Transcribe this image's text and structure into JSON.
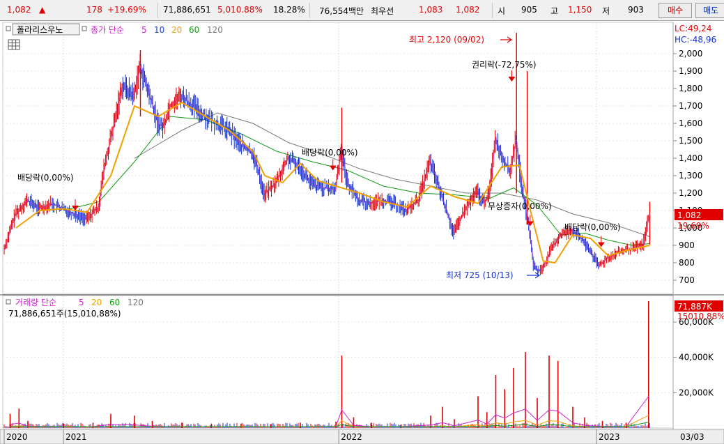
{
  "quote_bar": {
    "price": "1,082",
    "change_arrow": "▲",
    "change": "178",
    "change_pct": "+19.69%",
    "volume": "71,886,651",
    "volume_ratio": "5,010.88%",
    "turnover": "18.28%",
    "trade_value": "76,554백만",
    "ask_label": "최우선",
    "best_ask": "1,083",
    "best_bid": "1,082",
    "open_label": "시",
    "open": "905",
    "high_label": "고",
    "high": "1,150",
    "low_label": "저",
    "low": "903",
    "buy_label": "매수",
    "sell_label": "매도"
  },
  "price_panel": {
    "name_tag": "폴라리스우노",
    "ma_title": "종가 단순",
    "ma_periods": [
      "5",
      "10",
      "20",
      "60",
      "120"
    ],
    "lc_label": "LC:49,24",
    "hc_label": "HC:-48,96",
    "current_price_label": "1,082",
    "current_pct_label": "19,69%",
    "annotations": {
      "high": "최고 2,120 (09/02)",
      "rights_off": "권리락(-72,75%)",
      "div1": "배당락(0,00%)",
      "div2": "배당락(0,00%)",
      "bonus": "무상증자(0,00%)",
      "div3": "배당락(0,00%)",
      "low": "최저 725 (10/13)"
    }
  },
  "volume_panel": {
    "title": "거래량 단순",
    "ma_periods": [
      "5",
      "20",
      "60",
      "120"
    ],
    "summary": "71,886,651주(15,010,88%)",
    "current_volume_label": "71,887K",
    "current_pct_label": "15010,88%"
  },
  "colors": {
    "candle_up": "#e00000",
    "candle_down": "#1530d0",
    "ma5": "#d020d0",
    "ma10": "#1e3cc8",
    "ma20": "#f0a000",
    "ma60": "#119911",
    "ma120": "#777777"
  },
  "chart_data": {
    "type": "candlestick",
    "x_axis_labels": [
      "2020",
      "2021",
      "2022",
      "2023",
      "03/03"
    ],
    "price_axis_ticks": [
      "700",
      "800",
      "900",
      "1,000",
      "1,100",
      "1,200",
      "1,300",
      "1,400",
      "1,500",
      "1,600",
      "1,700",
      "1,800",
      "1,900",
      "2,000"
    ],
    "volume_axis_ticks": [
      "20,000K",
      "40,000K",
      "60,000K"
    ],
    "ylim_price": [
      620,
      2180
    ],
    "ylim_volume": [
      0,
      75000
    ],
    "price_path": [
      [
        0,
        870
      ],
      [
        0.02,
        1080
      ],
      [
        0.04,
        1160
      ],
      [
        0.06,
        1110
      ],
      [
        0.08,
        1140
      ],
      [
        0.1,
        1110
      ],
      [
        0.12,
        1080
      ],
      [
        0.14,
        1050
      ],
      [
        0.16,
        1120
      ],
      [
        0.17,
        1350
      ],
      [
        0.19,
        1650
      ],
      [
        0.2,
        1820
      ],
      [
        0.22,
        1760
      ],
      [
        0.23,
        1930
      ],
      [
        0.25,
        1720
      ],
      [
        0.26,
        1600
      ],
      [
        0.27,
        1580
      ],
      [
        0.28,
        1700
      ],
      [
        0.3,
        1760
      ],
      [
        0.32,
        1700
      ],
      [
        0.34,
        1640
      ],
      [
        0.36,
        1600
      ],
      [
        0.38,
        1560
      ],
      [
        0.4,
        1480
      ],
      [
        0.42,
        1430
      ],
      [
        0.43,
        1330
      ],
      [
        0.44,
        1190
      ],
      [
        0.46,
        1260
      ],
      [
        0.48,
        1400
      ],
      [
        0.5,
        1350
      ],
      [
        0.52,
        1250
      ],
      [
        0.54,
        1230
      ],
      [
        0.56,
        1220
      ],
      [
        0.57,
        1460
      ],
      [
        0.58,
        1260
      ],
      [
        0.6,
        1160
      ],
      [
        0.62,
        1140
      ],
      [
        0.64,
        1160
      ],
      [
        0.66,
        1140
      ],
      [
        0.68,
        1100
      ],
      [
        0.7,
        1160
      ],
      [
        0.72,
        1380
      ],
      [
        0.74,
        1180
      ],
      [
        0.76,
        970
      ],
      [
        0.78,
        1110
      ],
      [
        0.8,
        1210
      ],
      [
        0.81,
        1140
      ],
      [
        0.82,
        1200
      ],
      [
        0.83,
        1520
      ],
      [
        0.84,
        1420
      ],
      [
        0.855,
        1320
      ],
      [
        0.865,
        1510
      ],
      [
        0.875,
        1230
      ],
      [
        0.885,
        1040
      ],
      [
        0.895,
        780
      ],
      [
        0.905,
        750
      ],
      [
        0.915,
        800
      ],
      [
        0.925,
        880
      ],
      [
        0.94,
        960
      ],
      [
        0.96,
        990
      ],
      [
        0.975,
        940
      ],
      [
        0.99,
        870
      ],
      [
        1.005,
        780
      ],
      [
        1.02,
        830
      ],
      [
        1.04,
        860
      ],
      [
        1.06,
        880
      ],
      [
        1.08,
        905
      ],
      [
        1.09,
        1082
      ]
    ],
    "ma20_path": [
      [
        0.02,
        1000
      ],
      [
        0.06,
        1100
      ],
      [
        0.1,
        1110
      ],
      [
        0.14,
        1090
      ],
      [
        0.18,
        1300
      ],
      [
        0.22,
        1700
      ],
      [
        0.26,
        1640
      ],
      [
        0.3,
        1720
      ],
      [
        0.34,
        1640
      ],
      [
        0.38,
        1560
      ],
      [
        0.42,
        1440
      ],
      [
        0.44,
        1300
      ],
      [
        0.47,
        1260
      ],
      [
        0.5,
        1370
      ],
      [
        0.53,
        1270
      ],
      [
        0.56,
        1240
      ],
      [
        0.6,
        1200
      ],
      [
        0.64,
        1150
      ],
      [
        0.68,
        1120
      ],
      [
        0.72,
        1240
      ],
      [
        0.76,
        1180
      ],
      [
        0.8,
        1140
      ],
      [
        0.84,
        1350
      ],
      [
        0.87,
        1360
      ],
      [
        0.89,
        1080
      ],
      [
        0.91,
        810
      ],
      [
        0.93,
        800
      ],
      [
        0.96,
        960
      ],
      [
        0.99,
        940
      ],
      [
        1.02,
        840
      ],
      [
        1.05,
        870
      ],
      [
        1.09,
        900
      ]
    ],
    "ma60_path": [
      [
        0.1,
        1100
      ],
      [
        0.16,
        1150
      ],
      [
        0.22,
        1380
      ],
      [
        0.28,
        1640
      ],
      [
        0.34,
        1620
      ],
      [
        0.4,
        1540
      ],
      [
        0.46,
        1440
      ],
      [
        0.52,
        1380
      ],
      [
        0.58,
        1330
      ],
      [
        0.64,
        1240
      ],
      [
        0.7,
        1200
      ],
      [
        0.76,
        1190
      ],
      [
        0.82,
        1170
      ],
      [
        0.86,
        1230
      ],
      [
        0.9,
        1130
      ],
      [
        0.94,
        960
      ],
      [
        0.98,
        970
      ],
      [
        1.02,
        930
      ],
      [
        1.06,
        900
      ],
      [
        1.09,
        910
      ]
    ],
    "ma120_path": [
      [
        0.22,
        1400
      ],
      [
        0.3,
        1560
      ],
      [
        0.36,
        1660
      ],
      [
        0.42,
        1600
      ],
      [
        0.48,
        1490
      ],
      [
        0.54,
        1420
      ],
      [
        0.6,
        1340
      ],
      [
        0.66,
        1280
      ],
      [
        0.72,
        1240
      ],
      [
        0.78,
        1200
      ],
      [
        0.84,
        1200
      ],
      [
        0.9,
        1160
      ],
      [
        0.96,
        1080
      ],
      [
        1.02,
        1030
      ],
      [
        1.09,
        950
      ]
    ],
    "volume_bars": [
      [
        0.01,
        8000
      ],
      [
        0.025,
        11000
      ],
      [
        0.04,
        4000
      ],
      [
        0.1,
        2500
      ],
      [
        0.15,
        3000
      ],
      [
        0.18,
        8000
      ],
      [
        0.22,
        7000
      ],
      [
        0.25,
        4000
      ],
      [
        0.3,
        3000
      ],
      [
        0.35,
        2500
      ],
      [
        0.4,
        2500
      ],
      [
        0.45,
        2000
      ],
      [
        0.5,
        3000
      ],
      [
        0.56,
        3500
      ],
      [
        0.57,
        41000
      ],
      [
        0.59,
        6000
      ],
      [
        0.62,
        3000
      ],
      [
        0.67,
        2000
      ],
      [
        0.72,
        7000
      ],
      [
        0.74,
        12000
      ],
      [
        0.76,
        5000
      ],
      [
        0.8,
        18000
      ],
      [
        0.815,
        9000
      ],
      [
        0.83,
        30000
      ],
      [
        0.845,
        22000
      ],
      [
        0.86,
        34000
      ],
      [
        0.88,
        43000
      ],
      [
        0.9,
        17000
      ],
      [
        0.92,
        41000
      ],
      [
        0.935,
        38000
      ],
      [
        0.96,
        12000
      ],
      [
        0.98,
        6000
      ],
      [
        1.01,
        4000
      ],
      [
        1.05,
        3000
      ],
      [
        1.088,
        71887
      ]
    ],
    "date_axis_positions": [
      0,
      0.1,
      0.565,
      1.0,
      1.09
    ]
  }
}
